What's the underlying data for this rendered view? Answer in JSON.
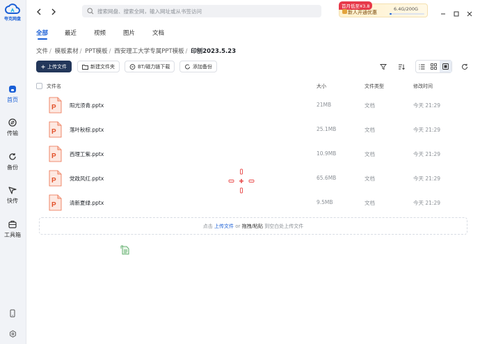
{
  "app": {
    "logo_text": "夸克网盘",
    "brand_color": "#1a5fd6"
  },
  "sidebar": {
    "items": [
      {
        "label": "首页",
        "icon": "home-icon",
        "active": true
      },
      {
        "label": "传输",
        "icon": "transfer-icon",
        "active": false
      },
      {
        "label": "备份",
        "icon": "backup-icon",
        "active": false
      },
      {
        "label": "快传",
        "icon": "quick-send-icon",
        "active": false
      },
      {
        "label": "工具箱",
        "icon": "toolbox-icon",
        "active": false
      }
    ],
    "bottom_icons": [
      "phone-icon",
      "settings-icon"
    ]
  },
  "search": {
    "placeholder": "搜索网盘、搜索全网，输入网址或从书签访问"
  },
  "vip": {
    "promo_tag": "首月低至¥3.8",
    "cta": "新人开通优惠",
    "quota": "6.4G/200G",
    "quota_fraction": 0.032
  },
  "tabs": [
    "全部",
    "最近",
    "视频",
    "图片",
    "文档"
  ],
  "active_tab": "全部",
  "breadcrumb": [
    "文件",
    "模板素材",
    "PPT模板",
    "西安理工大学专属PPT模板",
    "印刨2023.5.23"
  ],
  "toolbar": {
    "upload": "上传文件",
    "new_folder": "新建文件夹",
    "bt_download": "BT/磁力链下载",
    "add_backup": "添加备份"
  },
  "columns": {
    "name": "文件名",
    "size": "大小",
    "type": "文件类型",
    "mtime": "修改时间"
  },
  "files": [
    {
      "name": "阳光须青.pptx",
      "size": "21MB",
      "type": "文档",
      "mtime": "今天 21:29"
    },
    {
      "name": "落叶秋棕.pptx",
      "size": "25.1MB",
      "type": "文档",
      "mtime": "今天 21:29"
    },
    {
      "name": "西理工紫.pptx",
      "size": "10.9MB",
      "type": "文档",
      "mtime": "今天 21:29"
    },
    {
      "name": "党政风红.pptx",
      "size": "65.6MB",
      "type": "文档",
      "mtime": "今天 21:29"
    },
    {
      "name": "清新夏绿.pptx",
      "size": "9.5MB",
      "type": "文档",
      "mtime": "今天 21:29"
    }
  ],
  "upload_hint": {
    "prefix": "点击",
    "link": "上传文件",
    "or": "or",
    "drag": "拖拽/粘贴",
    "suffix": "到空白处上传文件"
  }
}
